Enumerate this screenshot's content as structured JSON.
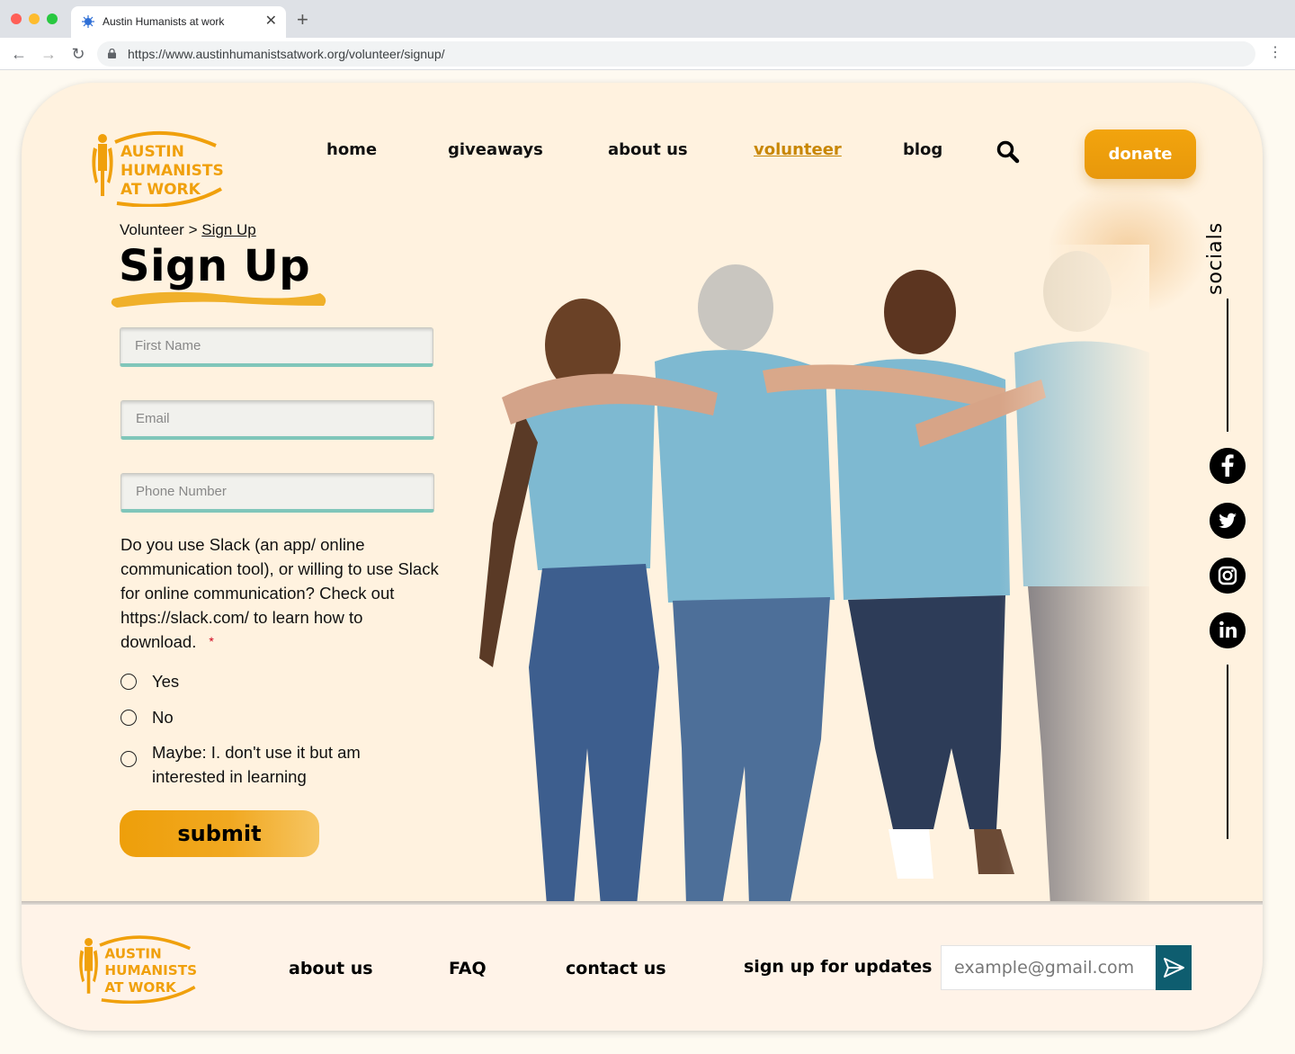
{
  "browser": {
    "tab_title": "Austin Humanists at work",
    "url": "https://www.austinhumanistsatwork.org/volunteer/signup/"
  },
  "header": {
    "logo_lines": [
      "AUSTIN",
      "HUMANISTS",
      "AT WORK"
    ],
    "nav": [
      {
        "label": "home"
      },
      {
        "label": "giveaways"
      },
      {
        "label": "about us"
      },
      {
        "label": "volunteer",
        "active": true
      },
      {
        "label": "blog"
      }
    ],
    "search_icon": "search-icon",
    "donate_label": "donate"
  },
  "breadcrumb": {
    "parent": "Volunteer",
    "separator": ">",
    "current": "Sign Up"
  },
  "page_title": "Sign Up",
  "form": {
    "first_name_placeholder": "First Name",
    "email_placeholder": "Email",
    "phone_placeholder": "Phone Number",
    "question": "Do you use Slack (an app/ online communication tool), or willing to use Slack for online communication? Check out https://slack.com/ to learn how to download.",
    "required_mark": "*",
    "options": [
      "Yes",
      "No",
      "Maybe: I. don't use it but am interested in learning"
    ],
    "submit_label": "submit"
  },
  "socials": {
    "label": "socials",
    "icons": [
      "facebook-icon",
      "twitter-icon",
      "instagram-icon",
      "linkedin-icon"
    ]
  },
  "footer": {
    "links": [
      "about us",
      "FAQ",
      "contact us"
    ],
    "signup_label": "sign up for updates",
    "email_placeholder": "example@gmail.com",
    "send_icon": "send-icon"
  },
  "colors": {
    "brand_orange": "#f0a00c",
    "active_nav": "#c88705",
    "card_bg": "#fff2df",
    "input_underline": "#80c6ba",
    "send_button": "#0e5d6f"
  }
}
